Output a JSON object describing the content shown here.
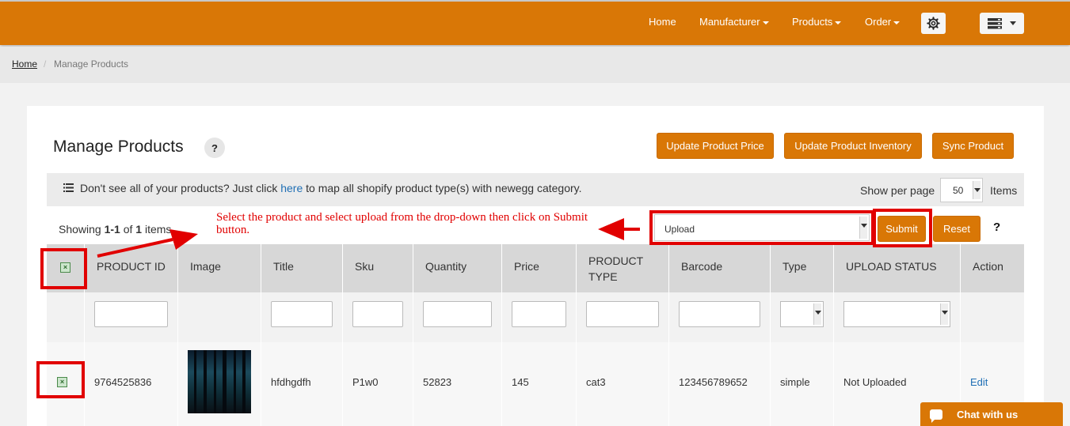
{
  "nav": {
    "home": "Home",
    "manufacturer": "Manufacturer",
    "products": "Products",
    "order": "Order"
  },
  "breadcrumb": {
    "home": "Home",
    "sep": "/",
    "current": "Manage Products"
  },
  "page": {
    "title": "Manage Products",
    "help": "?",
    "btn_update_price": "Update Product Price",
    "btn_update_inventory": "Update Product Inventory",
    "btn_sync": "Sync Product"
  },
  "info": {
    "text_before": "Don't see all of your products? Just click ",
    "link": "here",
    "text_after": " to map all shopify product type(s) with newegg category.",
    "show_per_page": "Show per page",
    "per_page_value": "50",
    "items_label": "Items"
  },
  "listing": {
    "showing_prefix": "Showing ",
    "range": "1-1",
    "of": " of ",
    "total": "1",
    "suffix": " items"
  },
  "annotation": {
    "instruction": "Select the product and select upload from the drop-down then click on Submit button."
  },
  "actions": {
    "bulk_value": "Upload",
    "submit": "Submit",
    "reset": "Reset",
    "help": "?"
  },
  "table": {
    "headers": {
      "product_id": "PRODUCT ID",
      "image": "Image",
      "title": "Title",
      "sku": "Sku",
      "quantity": "Quantity",
      "price": "Price",
      "product_type_1": "PRODUCT",
      "product_type_2": "TYPE",
      "barcode": "Barcode",
      "type": "Type",
      "upload_status": "UPLOAD STATUS",
      "action": "Action"
    },
    "row": {
      "product_id": "9764525836",
      "title": "hfdhgdfh",
      "sku": "P1w0",
      "quantity": "52823",
      "price": "145",
      "product_type": "cat3",
      "barcode": "123456789652",
      "type": "simple",
      "upload_status": "Not Uploaded",
      "action": "Edit"
    }
  },
  "chat": {
    "label": "Chat with us"
  },
  "colors": {
    "brand_orange": "#d97706",
    "annotation_red": "#e10000",
    "link_blue": "#1f6fb5"
  }
}
